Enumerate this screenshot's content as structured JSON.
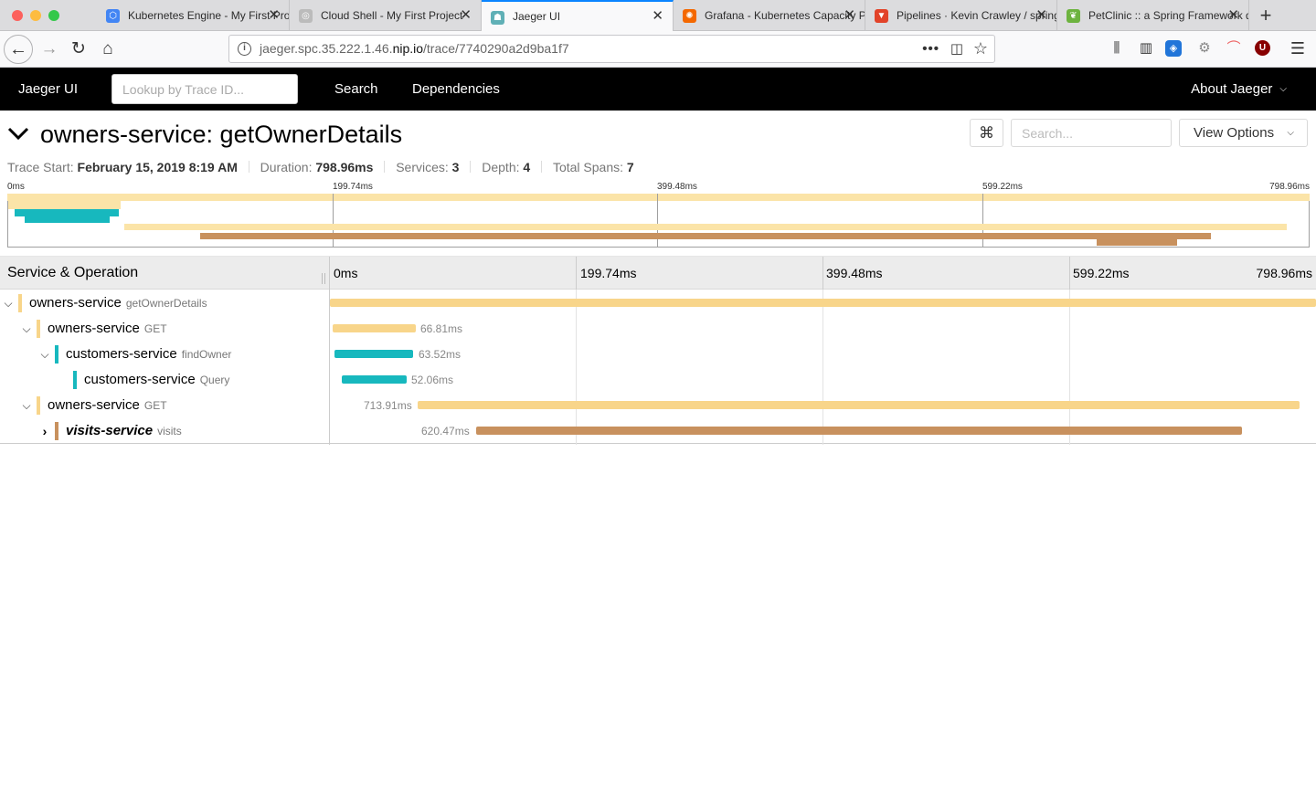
{
  "browser": {
    "tabs": [
      {
        "title": "Kubernetes Engine - My First Project"
      },
      {
        "title": "Cloud Shell - My First Project"
      },
      {
        "title": "Jaeger UI"
      },
      {
        "title": "Grafana - Kubernetes Capacity Planning"
      },
      {
        "title": "Pipelines · Kevin Crawley / spring-petclinic"
      },
      {
        "title": "PetClinic :: a Spring Framework demonstration"
      }
    ],
    "url_prefix": "jaeger.spc.35.222.1.46.",
    "url_domain": "nip.io",
    "url_path": "/trace/7740290a2d9ba1f7"
  },
  "jaeger_nav": {
    "brand": "Jaeger UI",
    "lookup_placeholder": "Lookup by Trace ID...",
    "search": "Search",
    "dependencies": "Dependencies",
    "about": "About Jaeger"
  },
  "trace": {
    "title": "owners-service: getOwnerDetails",
    "search_placeholder": "Search...",
    "view_options": "View Options",
    "meta": {
      "start_label": "Trace Start:",
      "start_value": "February 15, 2019 8:19 AM",
      "duration_label": "Duration:",
      "duration_value": "798.96ms",
      "services_label": "Services:",
      "services_value": "3",
      "depth_label": "Depth:",
      "depth_value": "4",
      "spans_label": "Total Spans:",
      "spans_value": "7"
    },
    "ticks": [
      "0ms",
      "199.74ms",
      "399.48ms",
      "599.22ms",
      "798.96ms"
    ]
  },
  "timeline": {
    "header_left": "Service & Operation",
    "rows": [
      {
        "service": "owners-service",
        "operation": "getOwnerDetails",
        "duration": "",
        "color": "#f8d58a"
      },
      {
        "service": "owners-service",
        "operation": "GET",
        "duration": "66.81ms",
        "color": "#f8d58a"
      },
      {
        "service": "customers-service",
        "operation": "findOwner",
        "duration": "63.52ms",
        "color": "#17b8be"
      },
      {
        "service": "customers-service",
        "operation": "Query",
        "duration": "52.06ms",
        "color": "#17b8be"
      },
      {
        "service": "owners-service",
        "operation": "GET",
        "duration": "713.91ms",
        "color": "#f8d58a"
      },
      {
        "service": "visits-service",
        "operation": "visits",
        "duration": "620.47ms",
        "color": "#c8915e"
      }
    ]
  }
}
